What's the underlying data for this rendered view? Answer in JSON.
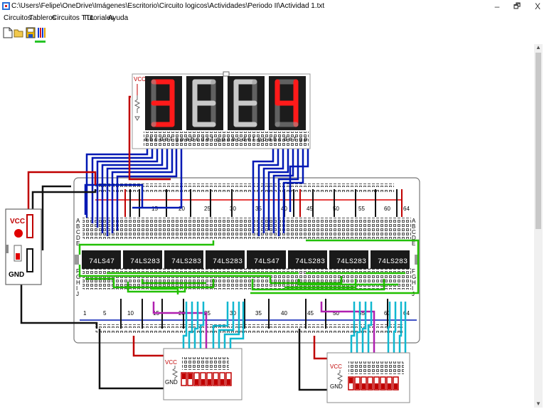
{
  "window": {
    "title": "C:\\Users\\Felipe\\OneDrive\\Imágenes\\Escritorio\\Circuito logicos\\Actividades\\Periodo II\\Actividad 1.txt",
    "minimize_glyph": "–",
    "maximize_glyph": "🗗",
    "close_glyph": "X"
  },
  "menu": [
    "Circuitos",
    "Tableros",
    "Circuitos TTL",
    "Tutoriales",
    "Ayuda"
  ],
  "toolbar": {
    "icons": [
      "new-file-icon",
      "open-folder-icon",
      "save-disk-icon",
      "chart-bars-icon"
    ]
  },
  "display": {
    "digits": [
      "3",
      "E",
      "E",
      "4"
    ],
    "lit": [
      true,
      false,
      false,
      true
    ],
    "vcc_label": "VCC",
    "pin_labels": [
      "a",
      "b",
      "c",
      "d",
      "e",
      "f",
      "g",
      "p",
      "a",
      "b",
      "c",
      "d",
      "e",
      "f",
      "g",
      "p",
      "a",
      "b",
      "c",
      "d",
      "e",
      "f",
      "g",
      "p",
      "a",
      "b",
      "c",
      "d",
      "e",
      "f",
      "g",
      "p"
    ]
  },
  "breadboard": {
    "top_numbers": [
      "15",
      "20",
      "25",
      "30",
      "35",
      "40",
      "45",
      "50",
      "55",
      "60",
      "64"
    ],
    "bottom_numbers": [
      "1",
      "5",
      "10",
      "15",
      "20",
      "25",
      "30",
      "35",
      "40",
      "45",
      "50",
      "55",
      "60",
      "64"
    ],
    "row_letters_top": [
      "A",
      "B",
      "C",
      "D",
      "E"
    ],
    "row_letters_bottom": [
      "F",
      "G",
      "H",
      "I",
      "J"
    ],
    "chips": [
      "74LS47",
      "74LS283",
      "74LS283",
      "74LS283",
      "74LS47",
      "74LS283",
      "74LS283",
      "74LS283"
    ]
  },
  "power_supply": {
    "vcc_label": "VCC",
    "gnd_label": "GND"
  },
  "dip_switches": [
    {
      "vcc_label": "VCC",
      "gnd_label": "GND",
      "states": [
        1,
        1,
        0,
        0,
        0,
        0,
        0,
        0
      ]
    },
    {
      "vcc_label": "VCC",
      "gnd_label": "GND",
      "states": [
        1,
        0,
        0,
        0,
        0,
        0,
        0,
        0
      ]
    }
  ],
  "colors": {
    "wire_red": "#c00000",
    "wire_blue": "#0018b4",
    "wire_green": "#22c000",
    "wire_cyan": "#10b8d0",
    "wire_magenta": "#b020b0",
    "wire_black": "#111111",
    "segment_on": "#ff1a1a",
    "segment_off": "#9a9a9a"
  }
}
